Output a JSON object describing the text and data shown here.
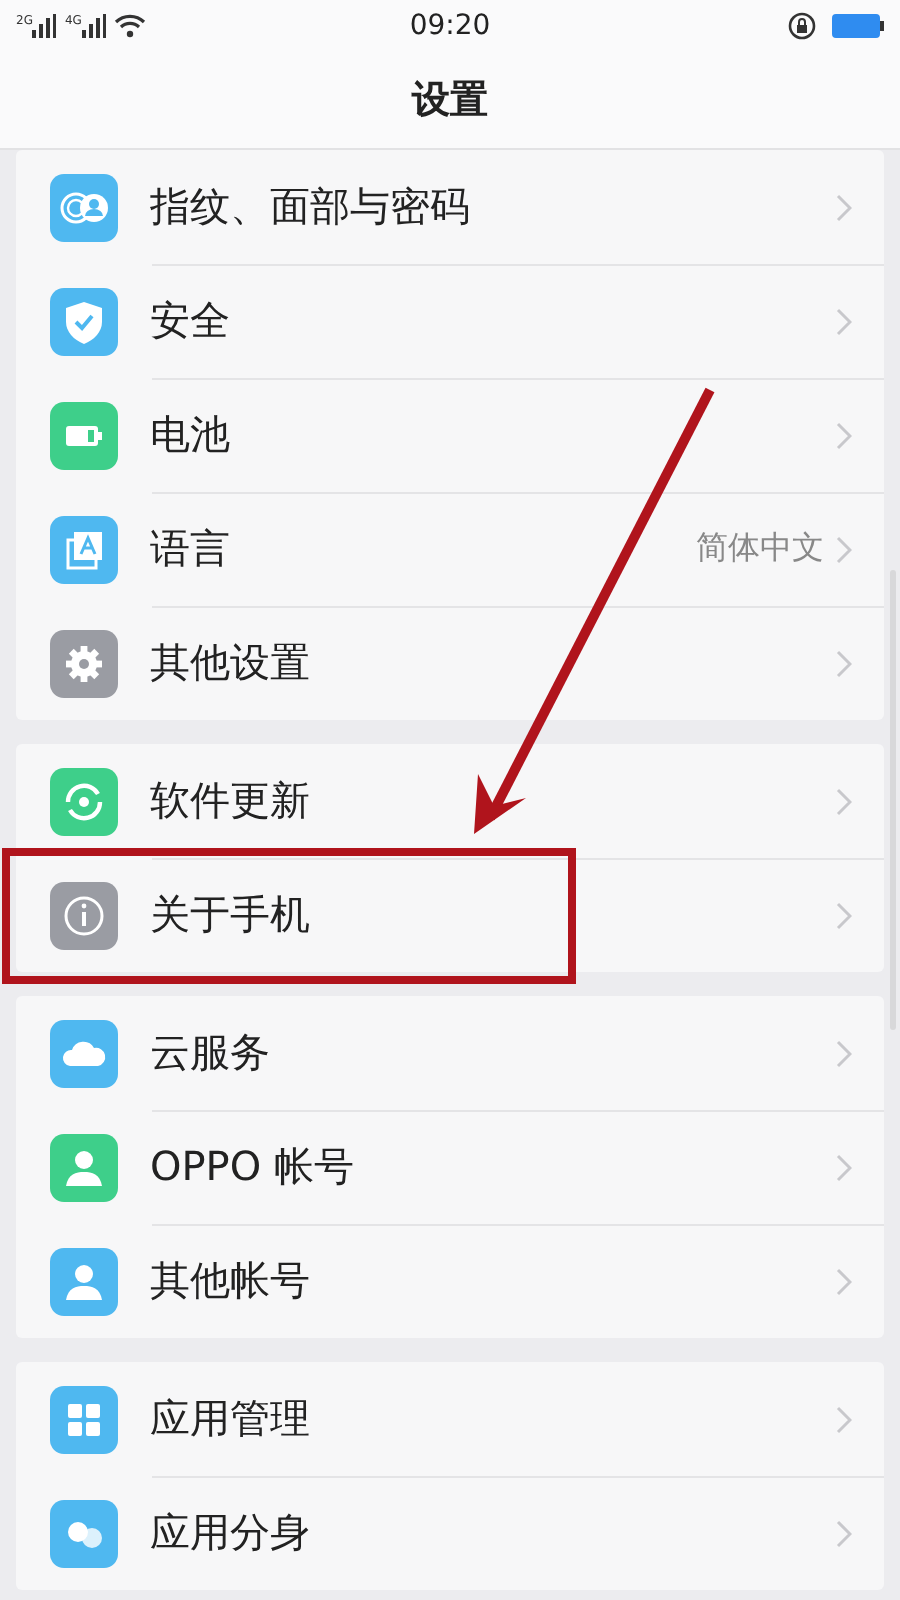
{
  "status_bar": {
    "networks": [
      "2G",
      "4G"
    ],
    "time": "09:20"
  },
  "title": "设置",
  "sections": [
    {
      "rows": [
        {
          "kind": "fingerprint",
          "color": "#4fb8f0",
          "label": "指纹、面部与密码",
          "highlighted": false
        },
        {
          "kind": "shield",
          "color": "#4fb8f0",
          "label": "安全",
          "highlighted": false
        },
        {
          "kind": "battery",
          "color": "#3ecf8a",
          "label": "电池",
          "highlighted": false
        },
        {
          "kind": "language",
          "color": "#4fb8f0",
          "label": "语言",
          "value": "简体中文",
          "highlighted": false
        },
        {
          "kind": "gear",
          "color": "#9a9ca3",
          "label": "其他设置",
          "highlighted": false
        }
      ]
    },
    {
      "rows": [
        {
          "kind": "update",
          "color": "#3ecf8a",
          "label": "软件更新",
          "highlighted": false
        },
        {
          "kind": "info",
          "color": "#9a9ca3",
          "label": "关于手机",
          "highlighted": true
        }
      ]
    },
    {
      "rows": [
        {
          "kind": "cloud",
          "color": "#4fb8f0",
          "label": "云服务",
          "highlighted": false
        },
        {
          "kind": "person",
          "color": "#3ecf8a",
          "label": "OPPO 帐号",
          "highlighted": false
        },
        {
          "kind": "person",
          "color": "#4fb8f0",
          "label": "其他帐号",
          "highlighted": false
        }
      ]
    },
    {
      "rows": [
        {
          "kind": "grid",
          "color": "#4fb8f0",
          "label": "应用管理",
          "highlighted": false
        },
        {
          "kind": "clone",
          "color": "#4fb8f0",
          "label": "应用分身",
          "highlighted": false
        }
      ]
    }
  ]
}
